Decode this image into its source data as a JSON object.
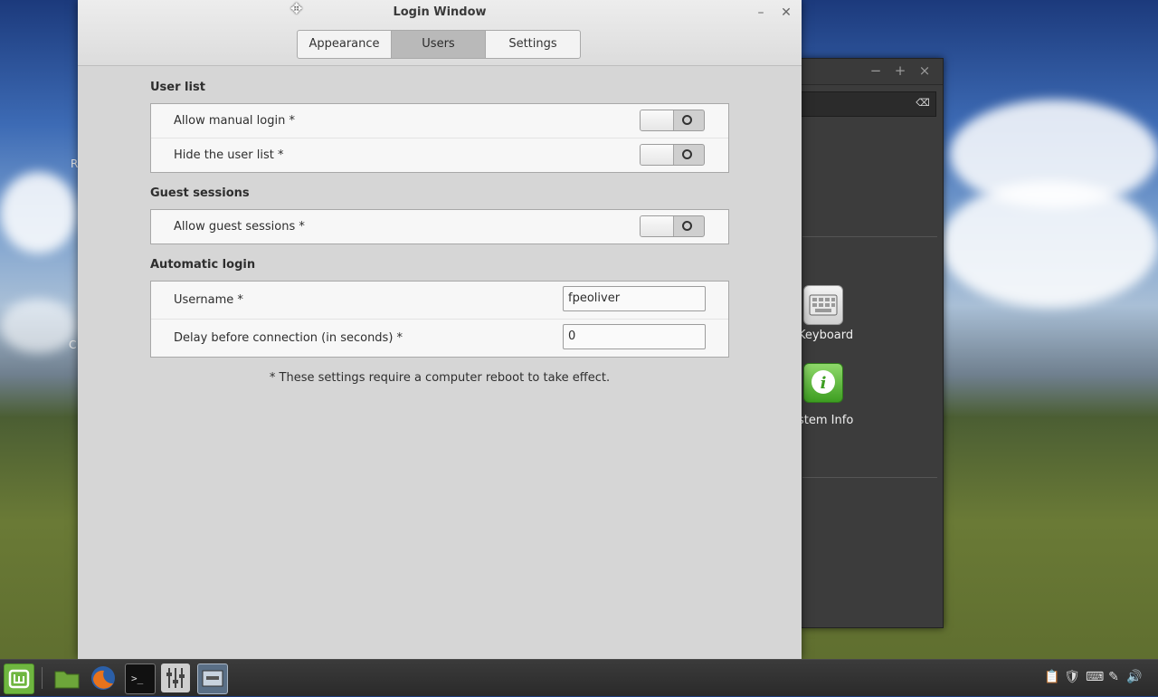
{
  "window": {
    "title": "Login Window",
    "minimize_icon": "minimize-icon",
    "close_icon": "close-icon",
    "tabs": [
      {
        "label": "Appearance",
        "active": false
      },
      {
        "label": "Users",
        "active": true
      },
      {
        "label": "Settings",
        "active": false
      }
    ]
  },
  "sections": {
    "user_list": {
      "title": "User list",
      "rows": [
        {
          "label": "Allow manual login *",
          "state": "off"
        },
        {
          "label": "Hide the user list *",
          "state": "off"
        }
      ]
    },
    "guest_sessions": {
      "title": "Guest sessions",
      "rows": [
        {
          "label": "Allow guest sessions *",
          "state": "off"
        }
      ]
    },
    "automatic_login": {
      "title": "Automatic login",
      "username_label": "Username *",
      "username_value": "fpeoliver",
      "delay_label": "Delay before connection (in seconds) *",
      "delay_value": "0"
    }
  },
  "note": "* These settings require a computer reboot to take effect.",
  "background_window": {
    "controls": [
      "−",
      "+",
      "×"
    ],
    "tiles": [
      {
        "label": "Keyboard",
        "icon": "keyboard-icon"
      },
      {
        "label": "stem Info",
        "icon": "info-icon"
      }
    ]
  },
  "taskbar": {
    "items": [
      "mint-menu-icon",
      "folder-icon",
      "firefox-icon",
      "terminal-icon",
      "settings-icon",
      "login-window-icon"
    ],
    "tray": [
      "clipboard-icon",
      "shield-icon",
      "keyboard-tray-icon",
      "network-icon",
      "volume-icon"
    ]
  },
  "colors": {
    "window_bg": "#d6d6d6",
    "active_tab": "#b9b9b9",
    "taskbar": "#2f2f2f"
  }
}
